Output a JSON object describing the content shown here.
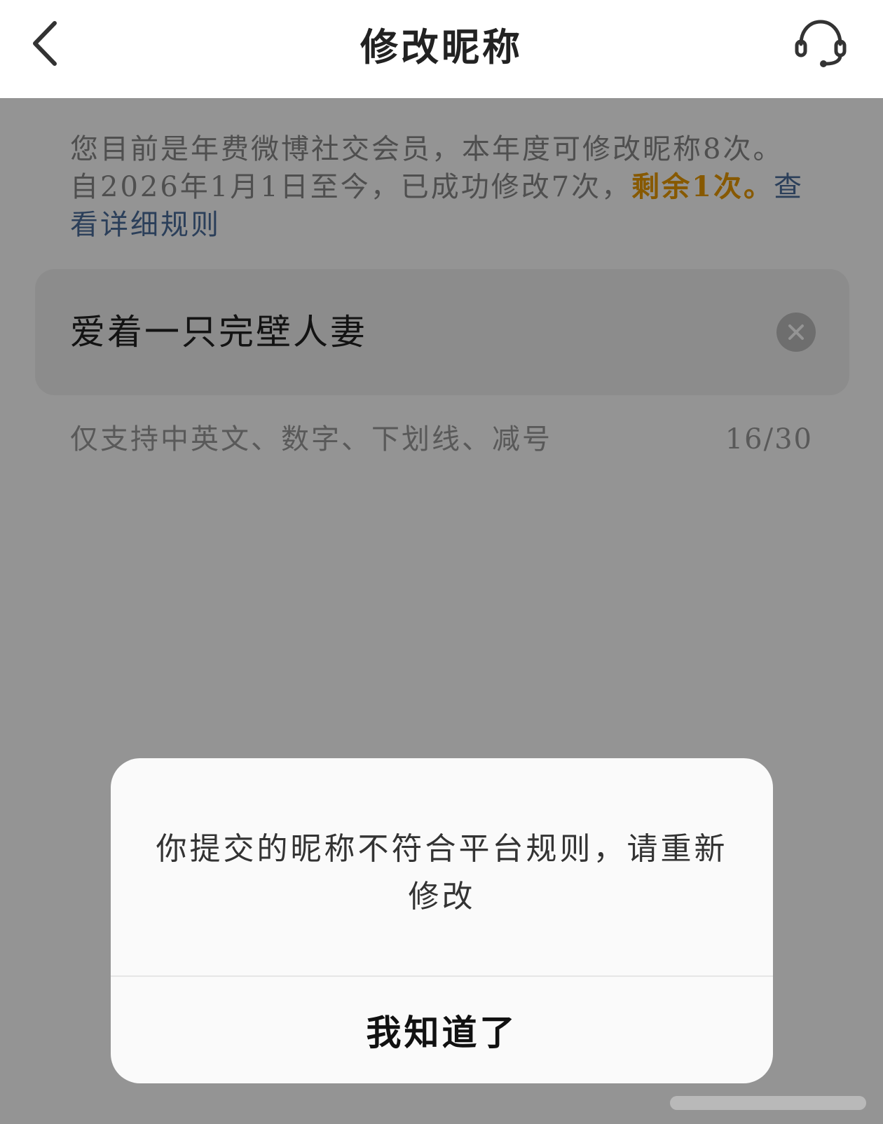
{
  "header": {
    "title": "修改昵称",
    "back_icon": "chevron-left-icon",
    "support_icon": "headset-icon"
  },
  "notice": {
    "text": "您目前是年费微博社交会员，本年度可修改昵称8次。自2026年1月1日至今，已成功修改7次，",
    "remaining": "剩余1次。",
    "rules_link": "查看详细规则"
  },
  "nickname_input": {
    "value": "爱着一只完壁人妻",
    "clear_icon": "clear-icon"
  },
  "hint": {
    "text": "仅支持中英文、数字、下划线、减号",
    "counter": "16/30"
  },
  "dialog": {
    "message": "你提交的昵称不符合平台规则，请重新修改",
    "confirm_label": "我知道了"
  },
  "colors": {
    "accent_orange": "#e89a00",
    "link_blue": "#4a6d9c",
    "overlay": "rgba(0,0,0,0.42)"
  }
}
